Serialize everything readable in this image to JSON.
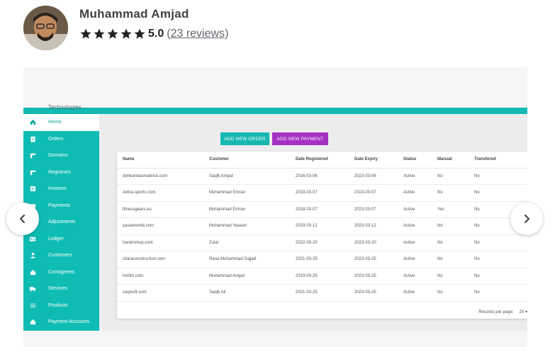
{
  "seller": {
    "name": "Muhammad Amjad",
    "rating": "5.0",
    "reviews_prefix": "(",
    "reviews_link": "23 reviews",
    "reviews_suffix": ")",
    "star_color": "#222325"
  },
  "app": {
    "header_text": "Technologies",
    "accent": "#13b9b3",
    "sidebar": [
      {
        "label": "Home",
        "icon": "home-icon",
        "active": true
      },
      {
        "label": "Orders",
        "icon": "clipboard-icon"
      },
      {
        "label": "Domains",
        "icon": "domain-icon"
      },
      {
        "label": "Registrars",
        "icon": "domain-icon"
      },
      {
        "label": "Invoices",
        "icon": "invoice-icon"
      },
      {
        "label": "Payments",
        "icon": "payments-icon"
      },
      {
        "label": "Adjustments",
        "icon": "adjustments-icon"
      },
      {
        "label": "Ledger",
        "icon": "ledger-icon"
      },
      {
        "label": "Customers",
        "icon": "person-icon"
      },
      {
        "label": "Consignees",
        "icon": "home-icon"
      },
      {
        "label": "Services",
        "icon": "truck-icon"
      },
      {
        "label": "Products",
        "icon": "list-icon"
      },
      {
        "label": "Payment Accounts",
        "icon": "home-icon"
      }
    ],
    "buttons": {
      "add_order": "ADD NEW ORDER",
      "add_payment": "ADD NEW PAYMENT"
    },
    "table": {
      "columns": [
        "Name",
        "Customer",
        "Date Registered",
        "Date Expiry",
        "Status",
        "Manual",
        "Transfered"
      ],
      "rows": [
        [
          "dehkanbasmatirice.com",
          "Saqib Amjad",
          "2016-03-06",
          "2023-03-06",
          "Active",
          "No",
          "No"
        ],
        [
          "zebra-sports.com",
          "Muhammad Emran",
          "2018-03-07",
          "2023-03-07",
          "Active",
          "No",
          "No"
        ],
        [
          "fitnessgears.eu",
          "Muhammad Emran",
          "2018-03-07",
          "2023-03-07",
          "Active",
          "Yes",
          "No"
        ],
        [
          "yaseenemb.com",
          "Muhammad Yaseen",
          "2019-03-12",
          "2023-03-12",
          "Active",
          "No",
          "No"
        ],
        [
          "handnshop.com",
          "Zulal",
          "2022-03-20",
          "2023-03-20",
          "Active",
          "No",
          "No"
        ],
        [
          "sitaraconstruction.com",
          "Rana Muhammad Sajjad",
          "2021-03-25",
          "2023-03-25",
          "Active",
          "No",
          "No"
        ],
        [
          "hmlint.com",
          "Muhammad Amjad",
          "2019-03-25",
          "2023-03-25",
          "Active",
          "No",
          "No"
        ],
        [
          "saqisoft.com",
          "Saqib Ali",
          "2021-03-25",
          "2023-03-25",
          "Active",
          "No",
          "No"
        ]
      ],
      "records_label": "Records per page:",
      "records_value": "20"
    }
  },
  "carousel": {
    "prev_icon": "chevron-left-icon",
    "next_icon": "chevron-right-icon"
  }
}
